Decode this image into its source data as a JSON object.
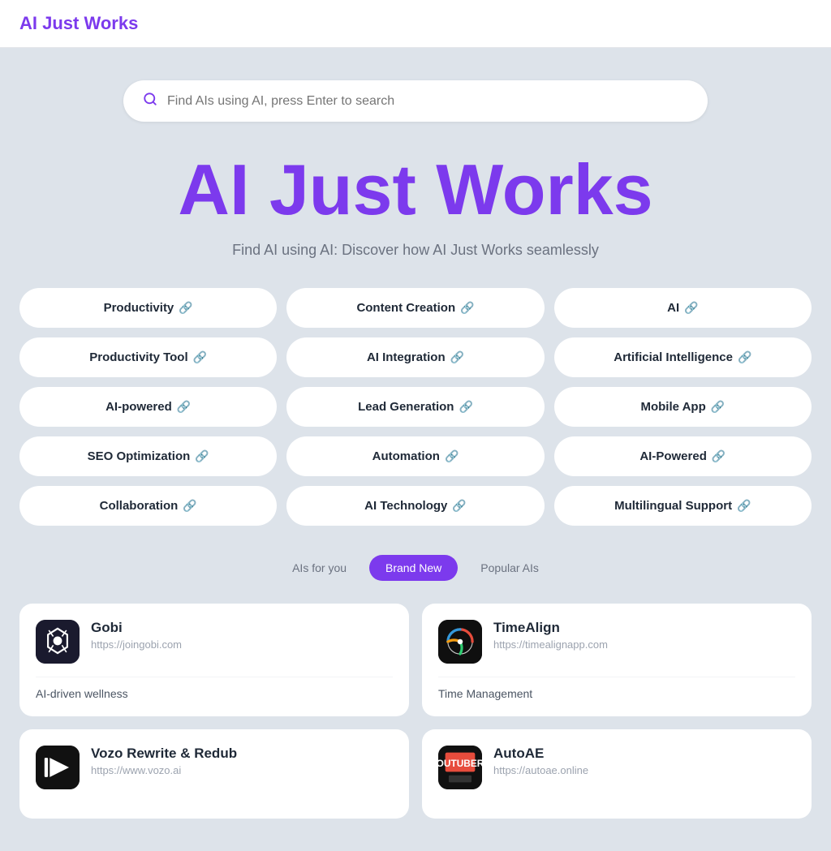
{
  "header": {
    "logo": "AI Just Works",
    "logo_href": "#"
  },
  "search": {
    "placeholder": "Find AIs using AI, press Enter to search"
  },
  "hero": {
    "title": "AI Just Works",
    "subtitle": "Find AI using AI: Discover how AI Just Works seamlessly"
  },
  "tags": [
    {
      "id": "productivity",
      "label": "Productivity"
    },
    {
      "id": "content-creation",
      "label": "Content Creation"
    },
    {
      "id": "ai",
      "label": "AI"
    },
    {
      "id": "productivity-tool",
      "label": "Productivity Tool"
    },
    {
      "id": "ai-integration",
      "label": "AI Integration"
    },
    {
      "id": "artificial-intelligence",
      "label": "Artificial Intelligence"
    },
    {
      "id": "ai-powered",
      "label": "AI-powered"
    },
    {
      "id": "lead-generation",
      "label": "Lead Generation"
    },
    {
      "id": "mobile-app",
      "label": "Mobile App"
    },
    {
      "id": "seo-optimization",
      "label": "SEO Optimization"
    },
    {
      "id": "automation",
      "label": "Automation"
    },
    {
      "id": "ai-powered-2",
      "label": "AI-Powered"
    },
    {
      "id": "collaboration",
      "label": "Collaboration"
    },
    {
      "id": "ai-technology",
      "label": "AI Technology"
    },
    {
      "id": "multilingual-support",
      "label": "Multilingual Support"
    }
  ],
  "filter_tabs": [
    {
      "id": "ais-for-you",
      "label": "AIs for you",
      "active": false
    },
    {
      "id": "brand-new",
      "label": "Brand New",
      "active": true
    },
    {
      "id": "popular-ais",
      "label": "Popular AIs",
      "active": false
    }
  ],
  "cards": [
    {
      "id": "gobi",
      "name": "Gobi",
      "url": "https://joingobi.com",
      "description": "AI-driven wellness",
      "logo_type": "gobi"
    },
    {
      "id": "timealign",
      "name": "TimeAlign",
      "url": "https://timealignapp.com",
      "description": "Time Management",
      "logo_type": "timealign"
    },
    {
      "id": "vozo",
      "name": "Vozo Rewrite & Redub",
      "url": "https://www.vozo.ai",
      "description": "",
      "logo_type": "vozo"
    },
    {
      "id": "autoae",
      "name": "AutoAE",
      "url": "https://autoae.online",
      "description": "",
      "logo_type": "autoae"
    }
  ]
}
